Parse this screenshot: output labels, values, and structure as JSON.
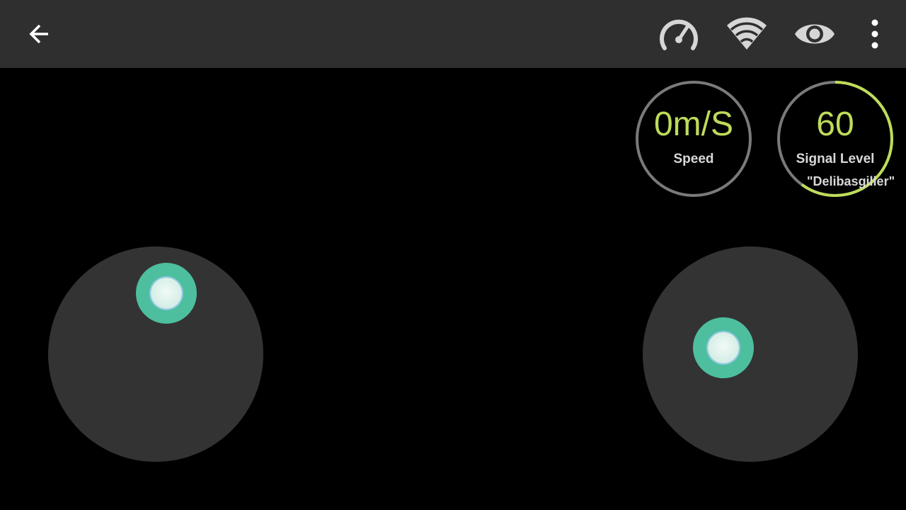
{
  "toolbar": {
    "icons": {
      "back": "arrow-back-icon",
      "speed": "speedometer-icon",
      "wifi": "wifi-icon",
      "view": "eye-icon",
      "more": "more-vert-icon"
    }
  },
  "gauges": {
    "speed": {
      "value": "0m/S",
      "label": "Speed",
      "level": 0
    },
    "signal": {
      "value": "60",
      "label": "Signal Level",
      "ssid": "\"Delibasgiller\"",
      "level": 0.6
    }
  },
  "colors": {
    "toolbar_bg": "#2f2f2f",
    "accent_value": "#bedc5a",
    "ring_track": "#7a7a7a",
    "ring_fill": "#bedc5a",
    "joystick_base": "#333333",
    "knob": "#4dbf9f"
  },
  "joysticks": {
    "left": {
      "name": "left-joystick"
    },
    "right": {
      "name": "right-joystick"
    }
  }
}
